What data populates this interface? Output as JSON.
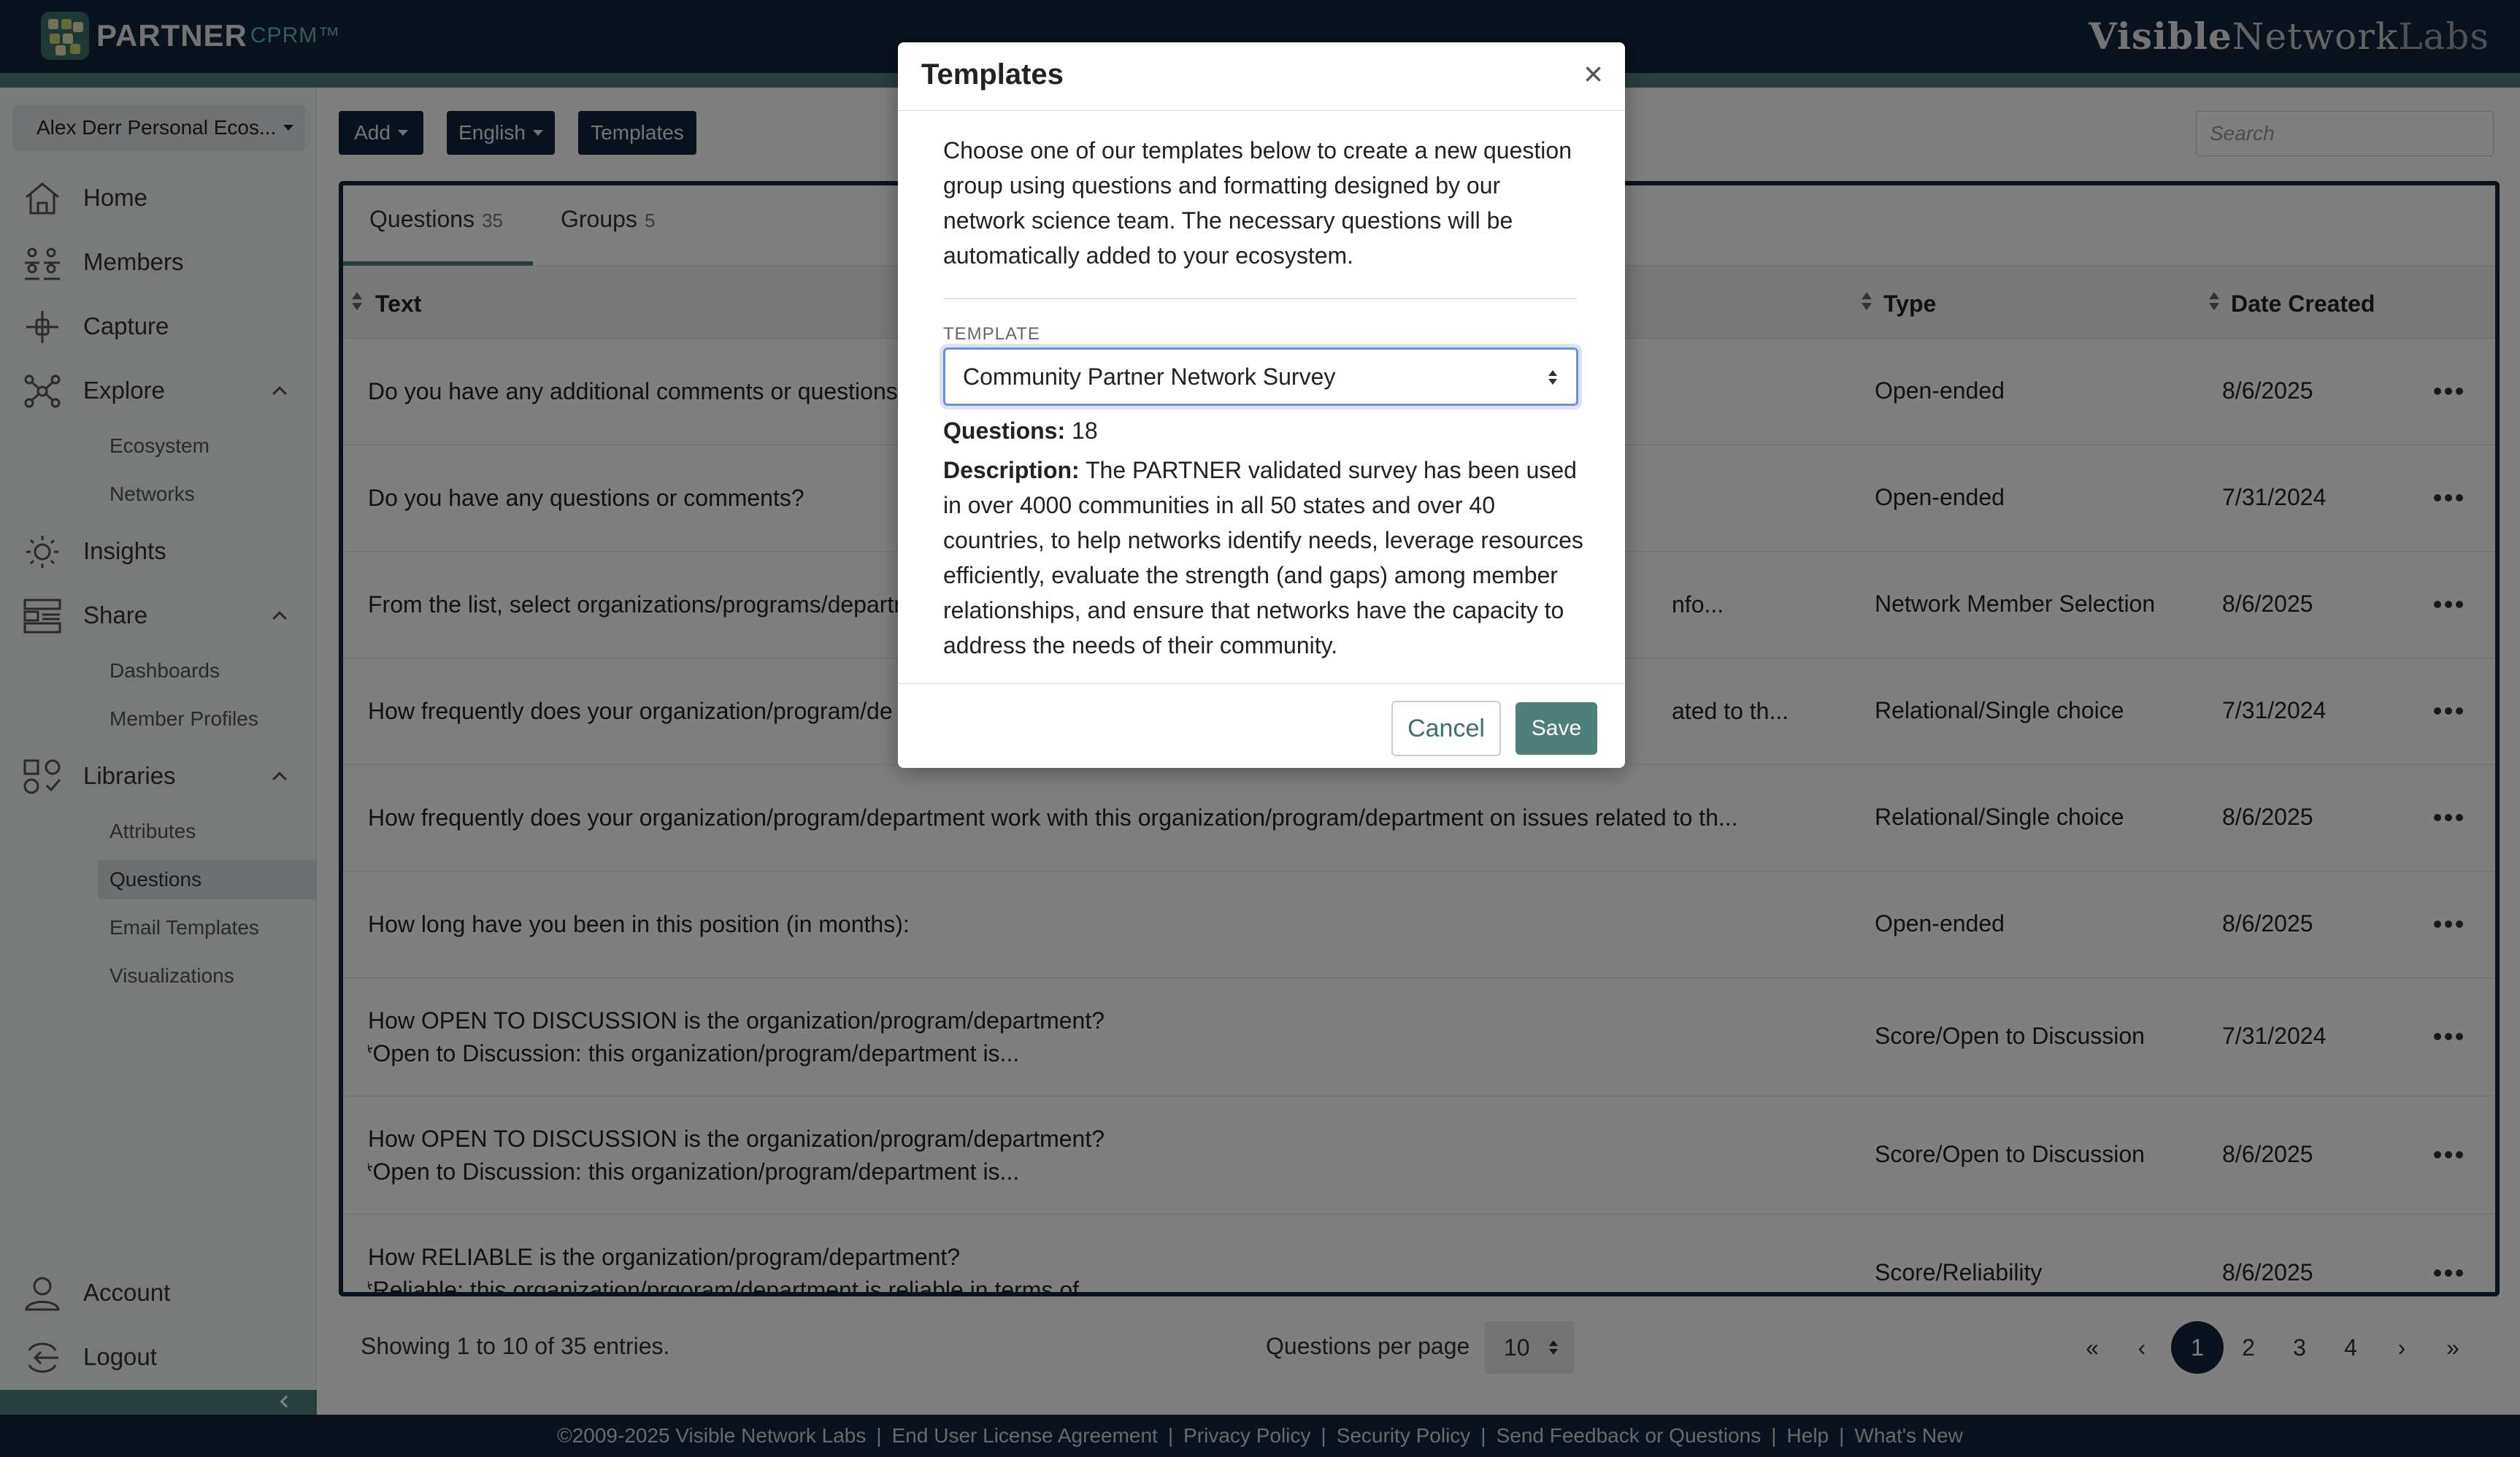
{
  "header": {
    "logo_word": "PARTNER",
    "logo_sub": "CPRM™",
    "brand_bold": "Visible",
    "brand_mid": "Network",
    "brand_light": "Labs"
  },
  "sidebar": {
    "ecosystem_select": "Alex Derr Personal Ecos...",
    "items": [
      {
        "label": "Home",
        "icon": "home-icon"
      },
      {
        "label": "Members",
        "icon": "members-icon"
      },
      {
        "label": "Capture",
        "icon": "capture-icon"
      },
      {
        "label": "Explore",
        "icon": "explore-icon"
      },
      {
        "label": "Insights",
        "icon": "insights-icon"
      },
      {
        "label": "Share",
        "icon": "share-icon"
      },
      {
        "label": "Libraries",
        "icon": "libraries-icon"
      },
      {
        "label": "Account",
        "icon": "account-icon"
      },
      {
        "label": "Logout",
        "icon": "logout-icon"
      }
    ],
    "explore_sub": [
      "Ecosystem",
      "Networks"
    ],
    "share_sub": [
      "Dashboards",
      "Member Profiles"
    ],
    "libraries_sub": [
      "Attributes",
      "Questions",
      "Email Templates",
      "Visualizations"
    ],
    "active_sub": "Questions"
  },
  "toolbar": {
    "add_label": "Add",
    "language_label": "English",
    "templates_label": "Templates",
    "search_placeholder": "Search"
  },
  "tabs": [
    {
      "label": "Questions",
      "count": "35"
    },
    {
      "label": "Groups",
      "count": "5"
    }
  ],
  "table": {
    "columns": [
      "Text",
      "Type",
      "Date Created"
    ],
    "rows": [
      {
        "text": "Do you have any additional comments or questions?",
        "text2": "",
        "type": "Open-ended",
        "date": "8/6/2025"
      },
      {
        "text": "Do you have any questions or comments?",
        "text2": "",
        "type": "Open-ended",
        "date": "7/31/2024"
      },
      {
        "text": "From the list, select organizations/programs/departr",
        "tail": "nfo...",
        "text2": "",
        "type": "Network Member Selection",
        "date": "8/6/2025"
      },
      {
        "text": "How frequently does your organization/program/de",
        "tail": "ated to th...",
        "text2": "",
        "type": "Relational/Single choice",
        "date": "7/31/2024"
      },
      {
        "text": "How frequently does your organization/program/department work with this organization/program/department on issues related to th...",
        "text2": "",
        "type": "Relational/Single choice",
        "date": "8/6/2025"
      },
      {
        "text": "How long have you been in this position (in months):",
        "text2": "",
        "type": "Open-ended",
        "date": "8/6/2025"
      },
      {
        "text": "How OPEN TO DISCUSSION is the organization/program/department?",
        "text2": "*Open to Discussion:  this organization/program/department is...",
        "type": "Score/Open to Discussion",
        "date": "7/31/2024"
      },
      {
        "text": "How OPEN TO DISCUSSION is the organization/program/department?",
        "text2": "*Open to Discussion:  this organization/program/department is...",
        "type": "Score/Open to Discussion",
        "date": "8/6/2025"
      },
      {
        "text": "How RELIABLE is the organization/program/department?",
        "text2": "*Reliable:  this organization/prgoram/department is reliable in terms of ...",
        "type": "Score/Reliability",
        "date": "8/6/2025"
      }
    ]
  },
  "pagination": {
    "showing": "Showing 1 to 10 of 35 entries.",
    "per_page_label": "Questions per page",
    "per_page_value": "10",
    "first": "«",
    "prev": "‹",
    "pages": [
      "1",
      "2",
      "3",
      "4"
    ],
    "next": "›",
    "last": "»",
    "current": "1"
  },
  "footer": {
    "links": [
      "©2009-2025 Visible Network Labs",
      "End User License Agreement",
      "Privacy Policy",
      "Security Policy",
      "Send Feedback or Questions",
      "Help",
      "What's New"
    ]
  },
  "modal": {
    "title": "Templates",
    "close": "×",
    "intro": "Choose one of our templates below to create a new question group using questions and formatting designed by our network science team. The necessary questions will be automatically added to your ecosystem.",
    "template_label": "TEMPLATE",
    "template_value": "Community Partner Network Survey",
    "questions_label": "Questions:",
    "questions_value": "18",
    "description_label": "Description:",
    "description_value": "The PARTNER validated survey has been used in over 4000 communities in all 50 states and over 40 countries, to help networks identify needs, leverage resources efficiently, evaluate the strength (and gaps) among member relationships, and ensure that networks have the capacity to address the needs of their community.",
    "cancel_label": "Cancel",
    "save_label": "Save"
  }
}
